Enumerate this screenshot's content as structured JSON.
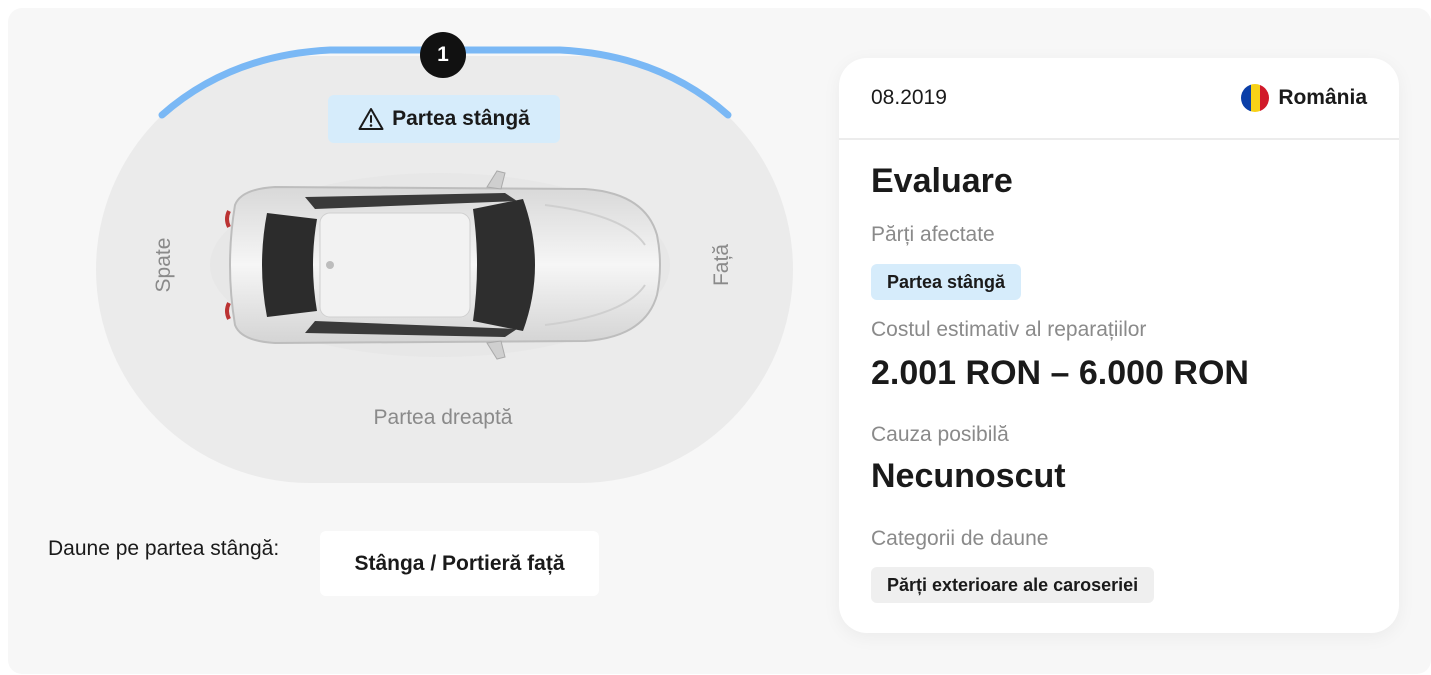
{
  "diagram": {
    "marker_number": "1",
    "highlighted_side": "Partea stângă",
    "label_back": "Spate",
    "label_front": "Față",
    "label_right": "Partea dreaptă",
    "arc_color": "#7ab8f5",
    "icon": "warning-triangle-icon"
  },
  "damage": {
    "label": "Daune pe partea stângă:",
    "value": "Stânga / Portieră față"
  },
  "card": {
    "date": "08.2019",
    "country": "România",
    "flag_colors": [
      "#0b3fa8",
      "#f7d117",
      "#d11a2a"
    ],
    "title": "Evaluare",
    "affected_parts_label": "Părți afectate",
    "affected_parts_value": "Partea stângă",
    "cost_label": "Costul estimativ al reparațiilor",
    "cost_value": "2.001 RON – 6.000 RON",
    "cause_label": "Cauza posibilă",
    "cause_value": "Necunoscut",
    "categories_label": "Categorii de daune",
    "categories_value": "Părți exterioare ale caroseriei"
  }
}
